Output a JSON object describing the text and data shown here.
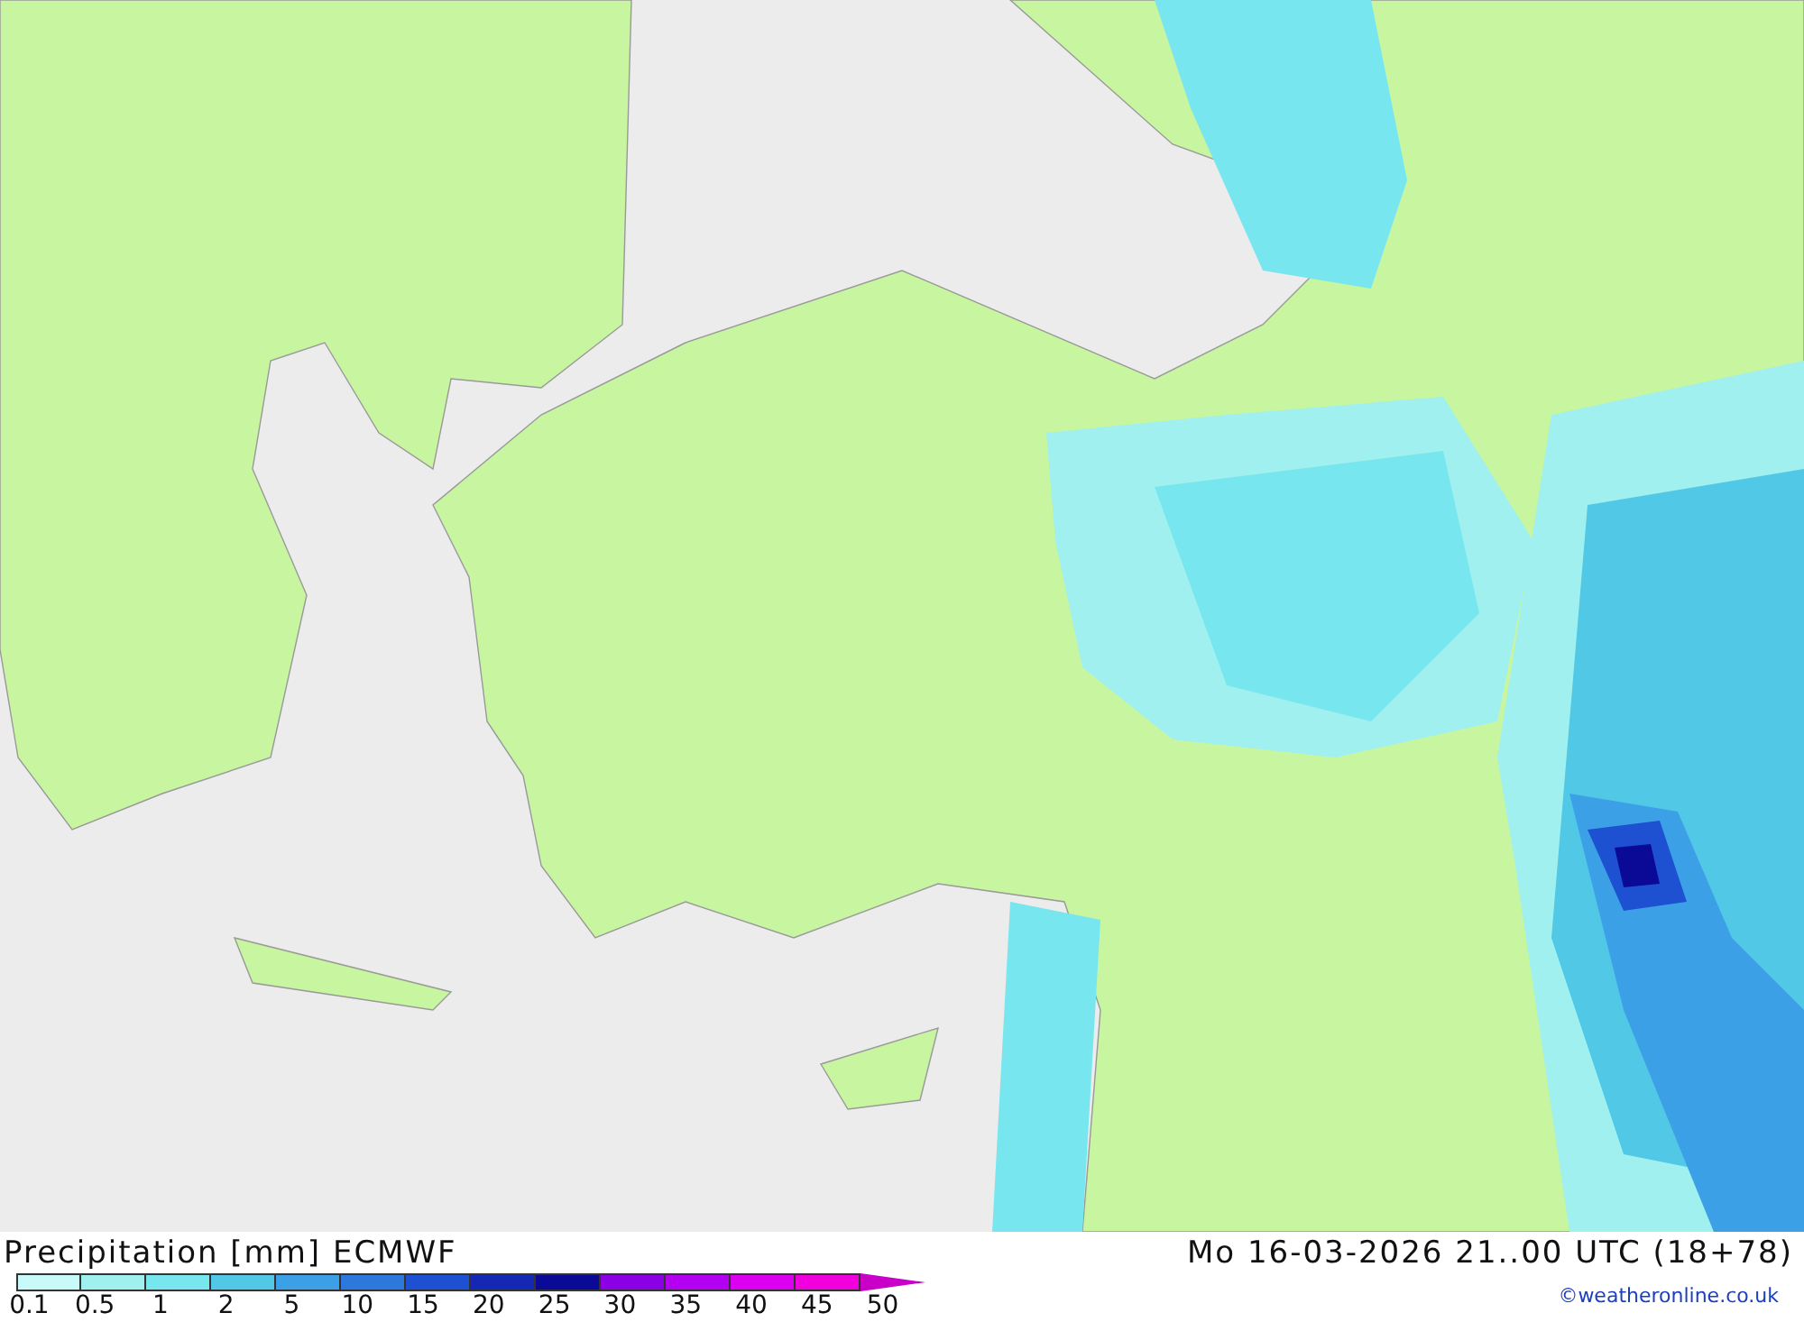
{
  "map": {
    "title": "Precipitation [mm] ECMWF",
    "datetime": "Mo 16-03-2026 21..00 UTC (18+78)"
  },
  "legend": {
    "swatches": [
      {
        "color": "#c8fafa"
      },
      {
        "color": "#a0f0f0"
      },
      {
        "color": "#78e6ee"
      },
      {
        "color": "#50c8e6"
      },
      {
        "color": "#3ca0e6"
      },
      {
        "color": "#2d78dc"
      },
      {
        "color": "#1e50d2"
      },
      {
        "color": "#1428b4"
      },
      {
        "color": "#0a0a96"
      },
      {
        "color": "#8c00e6"
      },
      {
        "color": "#b400f0"
      },
      {
        "color": "#dc00f0"
      },
      {
        "color": "#f000dc"
      },
      {
        "color": "#c800c8",
        "kind": "arrow"
      }
    ],
    "labels": [
      "0.1",
      "0.5",
      "1",
      "2",
      "5",
      "10",
      "15",
      "20",
      "25",
      "30",
      "35",
      "40",
      "45",
      "50"
    ]
  },
  "credit": "©weatheronline.co.uk"
}
